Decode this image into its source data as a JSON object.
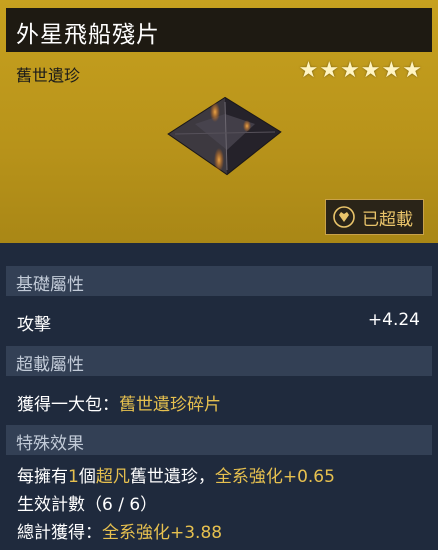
{
  "item": {
    "name": "外星飛船殘片",
    "category": "舊世遺珍",
    "star_count": 6,
    "star_glyph": "★",
    "overload_label": "已超載"
  },
  "sections": {
    "base": {
      "header": "基礎屬性",
      "stat_name": "攻擊",
      "stat_value": "+4.24"
    },
    "overload": {
      "header": "超載屬性",
      "line_prefix": "獲得一大包：",
      "line_highlight": "舊世遺珍碎片"
    },
    "special": {
      "header": "特殊效果",
      "line1": {
        "part1": "每擁有",
        "count": "1",
        "part2": "個",
        "rarity": "超凡",
        "part3": "舊世遺珍，",
        "effect": "全系強化+0.65"
      },
      "line2": "生效計數（6 / 6）",
      "line3": {
        "label": "總計獲得：",
        "value": "全系強化+3.88"
      }
    }
  },
  "colors": {
    "header_gold": "#c7a11f",
    "panel_bg": "#1f2a3d",
    "section_bg": "#334055",
    "highlight_gold": "#e6c04f"
  }
}
